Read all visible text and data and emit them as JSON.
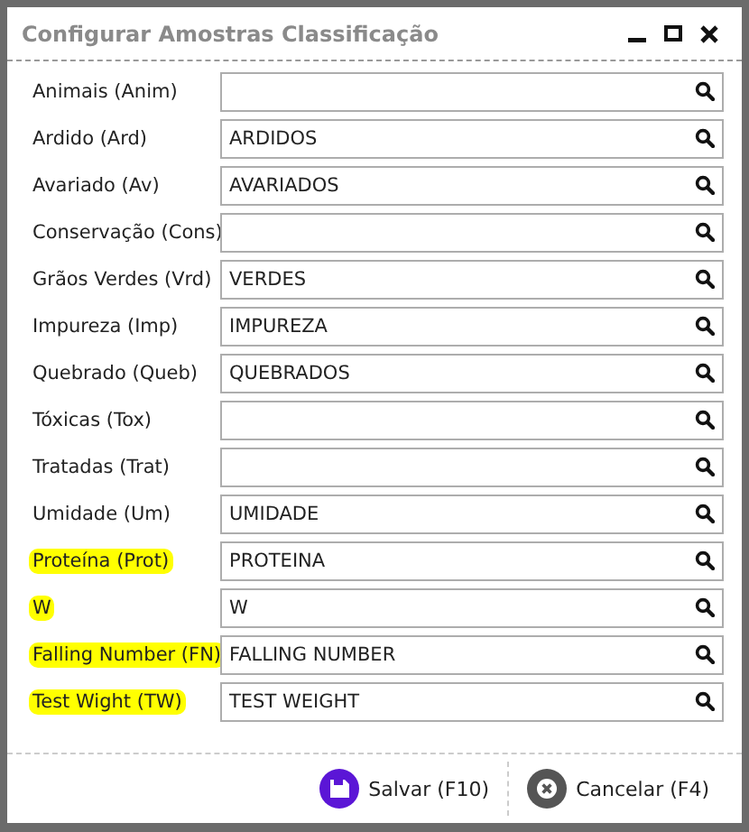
{
  "window": {
    "title": "Configurar Amostras Classificação"
  },
  "fields": [
    {
      "label": "Animais (Anim)",
      "highlighted": false
    },
    {
      "label": "Ardido (Ard)",
      "value": "ARDIDOS",
      "highlighted": false
    },
    {
      "label": "Avariado (Av)",
      "value": "AVARIADOS",
      "highlighted": false
    },
    {
      "label": "Conservação (Cons)",
      "highlighted": false
    },
    {
      "label": "Grãos Verdes (Vrd)",
      "value": "VERDES",
      "highlighted": false
    },
    {
      "label": "Impureza (Imp)",
      "value": "IMPUREZA",
      "highlighted": false
    },
    {
      "label": "Quebrado (Queb)",
      "value": "QUEBRADOS",
      "highlighted": false
    },
    {
      "label": "Tóxicas (Tox)",
      "highlighted": false
    },
    {
      "label": "Tratadas (Trat)",
      "highlighted": false
    },
    {
      "label": "Umidade (Um)",
      "value": "UMIDADE",
      "highlighted": false
    },
    {
      "label": "Proteína (Prot)",
      "value": "PROTEINA",
      "highlighted": true
    },
    {
      "label": "W",
      "value": "W",
      "highlighted": true
    },
    {
      "label": "Falling Number (FN)",
      "value": "FALLING NUMBER",
      "highlighted": true
    },
    {
      "label": "Test Wight (TW)",
      "value": "TEST WEIGHT",
      "highlighted": true
    }
  ],
  "buttons": [
    {
      "kind": "save",
      "label": "Salvar (F10)"
    },
    {
      "kind": "cancel",
      "label": "Cancelar (F4)"
    }
  ]
}
